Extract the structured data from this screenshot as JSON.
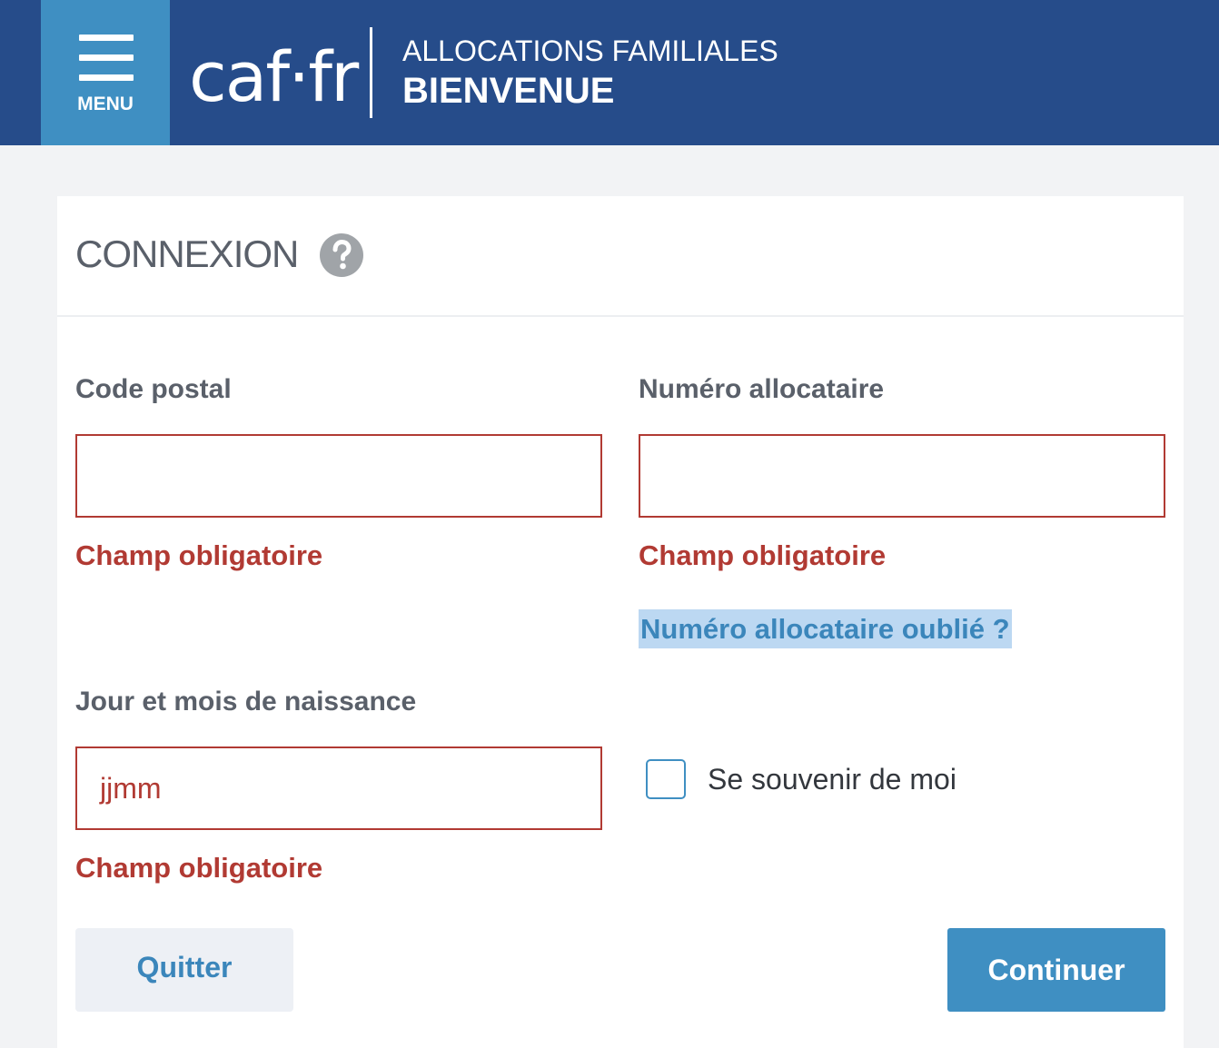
{
  "header": {
    "menu_label": "MENU",
    "logo_text": "caf·fr",
    "subtitle": "ALLOCATIONS FAMILIALES",
    "title": "BIENVENUE"
  },
  "card": {
    "title": "CONNEXION"
  },
  "form": {
    "postal_code": {
      "label": "Code postal",
      "value": "",
      "error": "Champ obligatoire"
    },
    "allocataire": {
      "label": "Numéro allocataire",
      "value": "",
      "error": "Champ obligatoire",
      "forgot_link": "Numéro allocataire oublié ?"
    },
    "birthday": {
      "label": "Jour et mois de naissance",
      "placeholder": "jjmm",
      "error": "Champ obligatoire"
    },
    "remember_me": {
      "label": "Se souvenir de moi",
      "checked": false
    }
  },
  "buttons": {
    "quit": "Quitter",
    "continue": "Continuer"
  },
  "colors": {
    "header_bg": "#264c8a",
    "menu_bg": "#3f8fc2",
    "error": "#b13a33",
    "link": "#3b86bb",
    "primary_button": "#3f8fc2"
  },
  "icons": {
    "menu": "hamburger-icon",
    "help": "question-circle-icon"
  }
}
